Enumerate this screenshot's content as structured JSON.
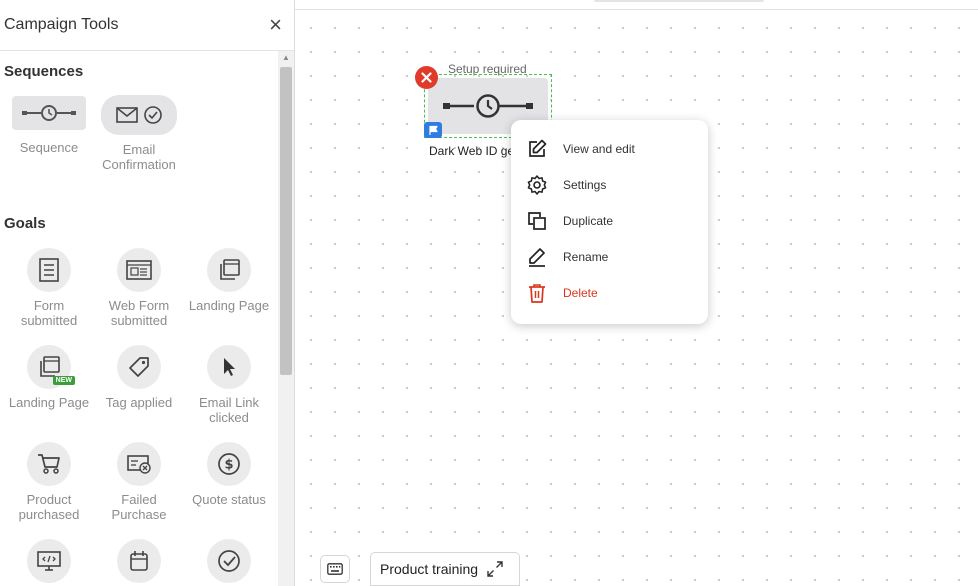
{
  "sidebar": {
    "title": "Campaign Tools",
    "close_label": "×",
    "sections": {
      "sequences": "Sequences",
      "goals": "Goals"
    },
    "sequence_tools": [
      {
        "label": "Sequence",
        "icon": "sequence-timer-icon"
      },
      {
        "label": "Email Confirmation",
        "icon": "email-confirm-icon"
      }
    ],
    "goal_tools": [
      {
        "label": "Form submitted",
        "icon": "form-icon"
      },
      {
        "label": "Web Form submitted",
        "icon": "web-form-icon"
      },
      {
        "label": "Landing Page",
        "icon": "landing-page-icon"
      },
      {
        "label": "Landing Page",
        "icon": "landing-page-new-icon",
        "badge": "NEW"
      },
      {
        "label": "Tag applied",
        "icon": "tag-icon"
      },
      {
        "label": "Email Link clicked",
        "icon": "cursor-icon"
      },
      {
        "label": "Product purchased",
        "icon": "cart-icon"
      },
      {
        "label": "Failed Purchase",
        "icon": "failed-purchase-icon"
      },
      {
        "label": "Quote status",
        "icon": "dollar-icon"
      },
      {
        "label": "",
        "icon": "code-monitor-icon"
      },
      {
        "label": "",
        "icon": "calendar-icon"
      },
      {
        "label": "",
        "icon": "check-circle-icon"
      }
    ]
  },
  "node": {
    "status": "Setup required",
    "name": "Dark Web ID ge"
  },
  "context_menu": {
    "items": [
      {
        "label": "View and edit",
        "icon": "edit-icon"
      },
      {
        "label": "Settings",
        "icon": "gear-icon"
      },
      {
        "label": "Duplicate",
        "icon": "duplicate-icon"
      },
      {
        "label": "Rename",
        "icon": "pen-icon"
      },
      {
        "label": "Delete",
        "icon": "trash-icon"
      }
    ]
  },
  "bottom": {
    "training_label": "Product training"
  },
  "colors": {
    "danger": "#d9361c",
    "success_dash": "#4cbe4c",
    "flag_blue": "#2f7de1",
    "error_red": "#e03a2a"
  }
}
